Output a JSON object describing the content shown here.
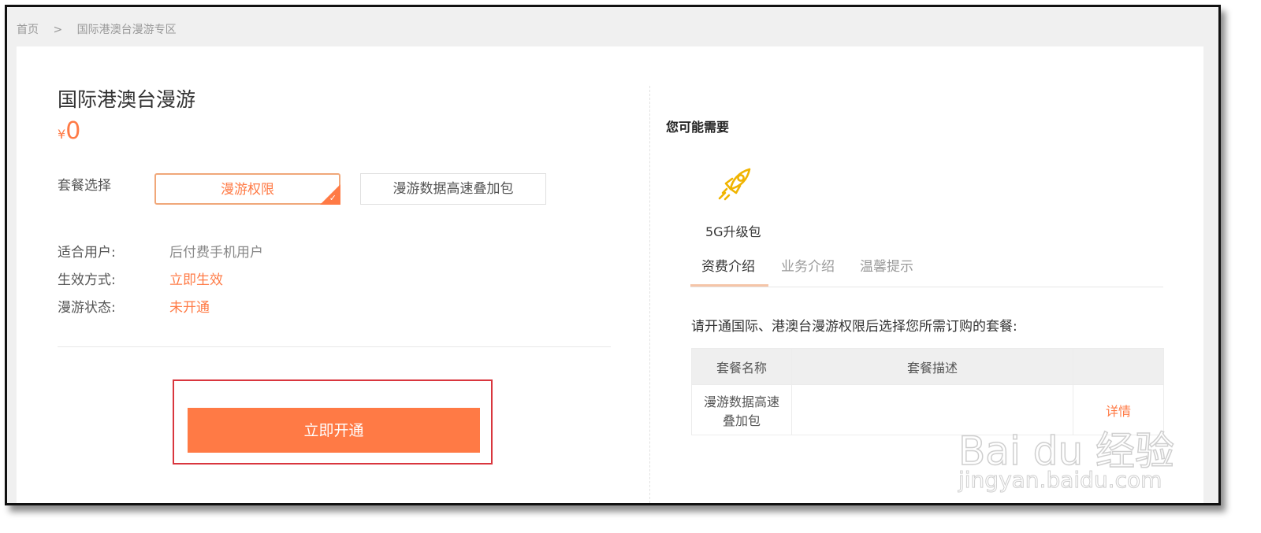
{
  "breadcrumb": {
    "home": "首页",
    "sep": ">",
    "current": "国际港澳台漫游专区"
  },
  "product": {
    "title": "国际港澳台漫游",
    "currency": "¥",
    "price": "0",
    "package_label": "套餐选择",
    "packages": [
      {
        "label": "漫游权限",
        "selected": true
      },
      {
        "label": "漫游数据高速叠加包",
        "selected": false
      }
    ],
    "info": [
      {
        "label": "适合用户:",
        "value": "后付费手机用户"
      },
      {
        "label": "生效方式:",
        "value": "立即生效"
      },
      {
        "label": "漫游状态:",
        "value": "未开通"
      }
    ],
    "open_button": "立即开通"
  },
  "side": {
    "heading": "您可能需要",
    "upgrade_label": "5G升级包",
    "tabs": [
      "资费介绍",
      "业务介绍",
      "温馨提示"
    ],
    "active_tab": 0,
    "note": "请开通国际、港澳台漫游权限后选择您所需订购的套餐:",
    "table": {
      "headers": [
        "套餐名称",
        "套餐描述",
        ""
      ],
      "rows": [
        {
          "name": "漫游数据高速叠加包",
          "desc": "",
          "action": "详情"
        }
      ]
    }
  },
  "watermark": {
    "brand": "Bai du 经验",
    "url": "jingyan.baidu.com"
  },
  "colors": {
    "accent": "#ff7a45",
    "highlight_border": "#d9363e",
    "icon_gold": "#f0b400"
  },
  "icons": {
    "upgrade": "rocket-icon",
    "selected": "check-icon"
  }
}
